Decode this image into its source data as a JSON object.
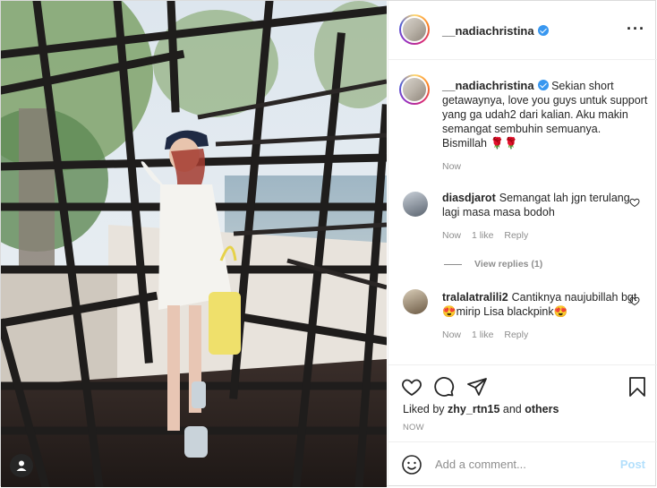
{
  "post": {
    "username": "__nadiachristina",
    "caption": "Sekian short getawaynya, love you guys untuk support yang ga udah2 dari kalian. Aku makin semangat sembuhin semuanya. Bismillah 🌹🌹",
    "caption_time": "Now",
    "more_icon": "more-options-icon"
  },
  "comments": [
    {
      "user": "diasdjarot",
      "text": "Semangat lah jgn terulang lagi masa masa bodoh",
      "time": "Now",
      "likes": "1 like",
      "reply": "Reply",
      "view_replies": "View replies (1)"
    },
    {
      "user": "tralalatralili2",
      "text": "Cantiknya naujubillah bgt😍mirip Lisa blackpink😍",
      "time": "Now",
      "likes": "1 like",
      "reply": "Reply"
    }
  ],
  "actions": {
    "icons": [
      "heart-icon",
      "comment-icon",
      "share-icon",
      "bookmark-icon"
    ],
    "liked_by_prefix": "Liked by",
    "liked_by_user": "zhy_rtn15",
    "liked_by_and": "and",
    "liked_by_others": "others",
    "timestamp": "NOW"
  },
  "add_comment": {
    "placeholder": "Add a comment...",
    "post_label": "Post"
  },
  "colors": {
    "verified": "#3897f0",
    "post_button_disabled": "#b2dffc",
    "muted_text": "#8e8e8e"
  }
}
